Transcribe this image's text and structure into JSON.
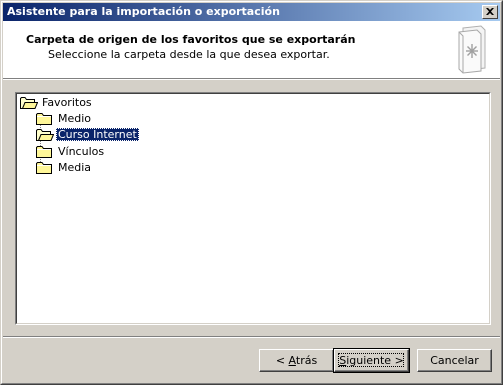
{
  "window": {
    "title": "Asistente para la importación o exportación"
  },
  "header": {
    "title": "Carpeta de origen de los favoritos que se exportarán",
    "subtitle": "Seleccione la carpeta desde la que desea exportar.",
    "icon": "favorites-export-icon"
  },
  "tree": {
    "root": {
      "label": "Favoritos",
      "icon": "folder-open-icon"
    },
    "children": [
      {
        "label": "Medio",
        "icon": "folder-icon",
        "selected": false
      },
      {
        "label": "Curso Internet",
        "icon": "folder-open-icon",
        "selected": true
      },
      {
        "label": "Vínculos",
        "icon": "folder-icon",
        "selected": false
      },
      {
        "label": "Media",
        "icon": "folder-icon",
        "selected": false
      }
    ]
  },
  "buttons": {
    "back_prefix": "< ",
    "back_hot": "A",
    "back_rest": "trás",
    "next_hot": "S",
    "next_rest": "iguiente >",
    "cancel": "Cancelar"
  },
  "colors": {
    "titlebar_start": "#0a246a",
    "titlebar_end": "#a6caf0",
    "selection": "#0a246a",
    "face": "#d4d0c8"
  }
}
